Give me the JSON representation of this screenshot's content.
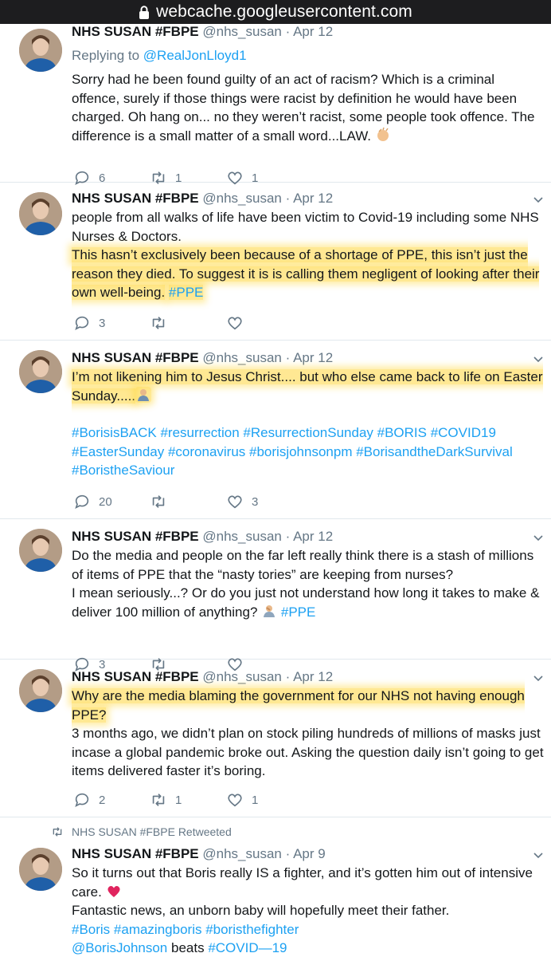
{
  "browser": {
    "url": "webcache.googleusercontent.com"
  },
  "tweets": [
    {
      "name": "NHS SUSAN #FBPE",
      "handle": "@nhs_susan",
      "sep": "·",
      "date": "Apr 12",
      "reply_prefix": "Replying to",
      "reply_to": "@RealJonLloyd1",
      "text": "Sorry had he been found guilty of an act of racism? Which is a criminal offence, surely if those things were racist by definition he would have been charged. Oh hang on... no they weren’t racist, some people took offence. The difference is a small matter of a small word...LAW.",
      "emoji": "clapping-hands-emoji",
      "replies": "6",
      "retweets": "1",
      "likes": "1"
    },
    {
      "name": "NHS SUSAN #FBPE",
      "handle": "@nhs_susan",
      "sep": "·",
      "date": "Apr 12",
      "text_line1": "people from all walks of life have been victim to Covid-19 including some NHS Nurses & Doctors.",
      "text_highlight": "This hasn’t exclusively been because of a shortage of PPE, this isn’t just the reason they died. To suggest it is is calling them negligent of looking after their own well-being.",
      "hashtag": "#PPE",
      "replies": "3",
      "retweets": "",
      "likes": ""
    },
    {
      "name": "NHS SUSAN #FBPE",
      "handle": "@nhs_susan",
      "sep": "·",
      "date": "Apr 12",
      "text_highlight": "I’m not likening him to Jesus Christ.... but who else came back to life on Easter Sunday.....",
      "emoji": "man-shrugging-emoji",
      "hashtags_line1": "#BorisisBACK #resurrection #ResurrectionSunday #BORIS #COVID19",
      "hashtags_line2": "#EasterSunday #coronavirus #borisjohnsonpm #BorisandtheDarkSurvival",
      "hashtags_line3": "#BoristheSaviour",
      "replies": "20",
      "retweets": "",
      "likes": "3"
    },
    {
      "name": "NHS SUSAN #FBPE",
      "handle": "@nhs_susan",
      "sep": "·",
      "date": "Apr 12",
      "text_line1": "Do the media and people on the far left really think there is a stash of millions of items of PPE that the “nasty tories” are keeping from nurses?",
      "text_line2": "I mean seriously...? Or do you just not understand how long it takes to make & deliver 100 million of anything?",
      "emoji": "man-facepalming-emoji",
      "hashtag": "#PPE",
      "replies": "3",
      "retweets": "",
      "likes": ""
    },
    {
      "name": "NHS SUSAN #FBPE",
      "handle": "@nhs_susan",
      "sep": "·",
      "date": "Apr 12",
      "text_highlight": "Why are the media blaming the government for our NHS not having enough PPE?",
      "text_line2": "3 months ago, we didn’t plan on stock piling hundreds of millions of masks just incase a global pandemic broke out. Asking the question daily isn’t going to get items delivered faster it’s boring.",
      "replies": "2",
      "retweets": "1",
      "likes": "1"
    },
    {
      "retweeted_label": "NHS SUSAN #FBPE Retweeted",
      "name": "NHS SUSAN #FBPE",
      "handle": "@nhs_susan",
      "sep": "·",
      "date": "Apr 9",
      "text_line1": "So it turns out that Boris really IS a fighter, and it’s gotten him out of intensive care.",
      "emoji": "red-heart-emoji",
      "text_line2": "Fantastic news, an unborn baby will hopefully meet their father.",
      "hashtags_line1": "#Boris #amazingboris #boristhefighter",
      "mention": "@BorisJohnson",
      "mention_suffix": " beats ",
      "hashtag_last": "#COVID—19"
    }
  ]
}
